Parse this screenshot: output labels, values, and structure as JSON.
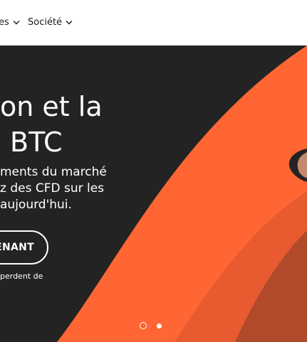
{
  "nav": {
    "items": [
      {
        "label": "es"
      },
      {
        "label": "Société"
      }
    ]
  },
  "hero": {
    "headline_line1": "on et la",
    "headline_line2": "BTC",
    "body_line1": "ments du marché",
    "body_line2": "z des CFD sur les",
    "body_line3": " aujourd'hui.",
    "cta_label": "ENANT",
    "risk_text": "perdent de",
    "colors": {
      "background": "#232323",
      "accent_orange": "#ff6633",
      "accent_orange_dark": "#e85a30",
      "accent_brown": "#b04a2a"
    },
    "carousel": {
      "slides": 2,
      "active_index": 1
    }
  }
}
